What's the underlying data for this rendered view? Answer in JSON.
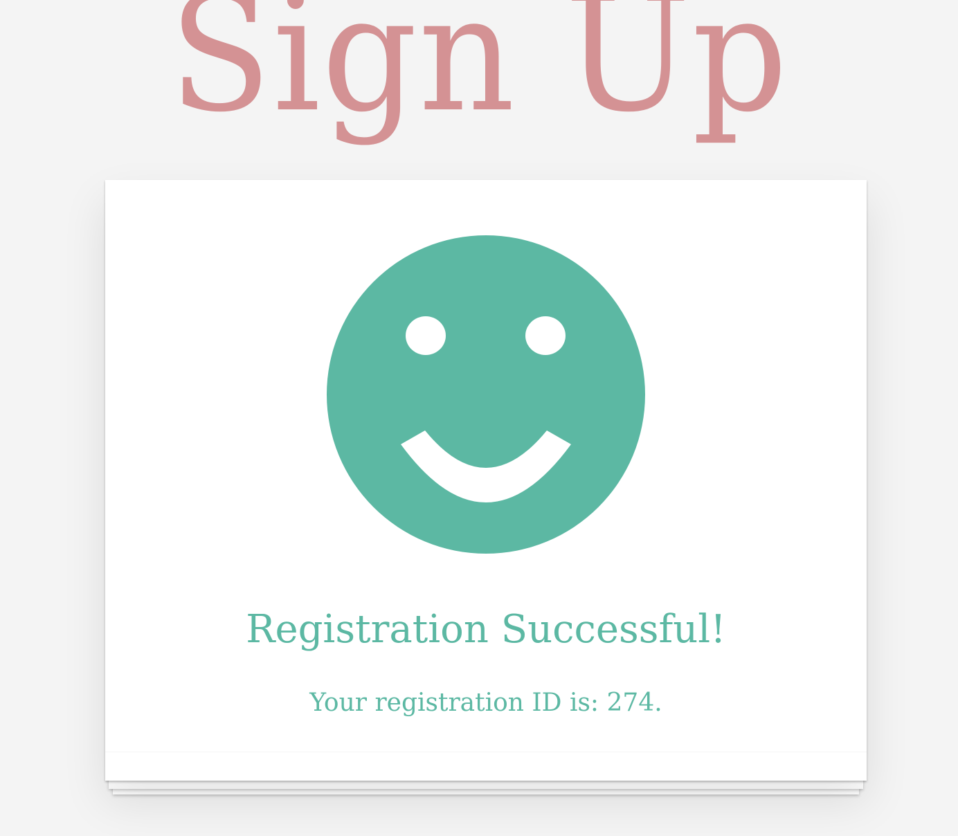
{
  "page": {
    "title": "Sign Up"
  },
  "result": {
    "heading": "Registration Successful!",
    "message_prefix": "Your registration ID is: ",
    "registration_id": "274",
    "message_suffix": "."
  },
  "icons": {
    "status": "smiley-face-icon"
  },
  "colors": {
    "title": "#d49294",
    "accent": "#5cb8a3",
    "background": "#f4f4f4",
    "card": "#ffffff"
  }
}
